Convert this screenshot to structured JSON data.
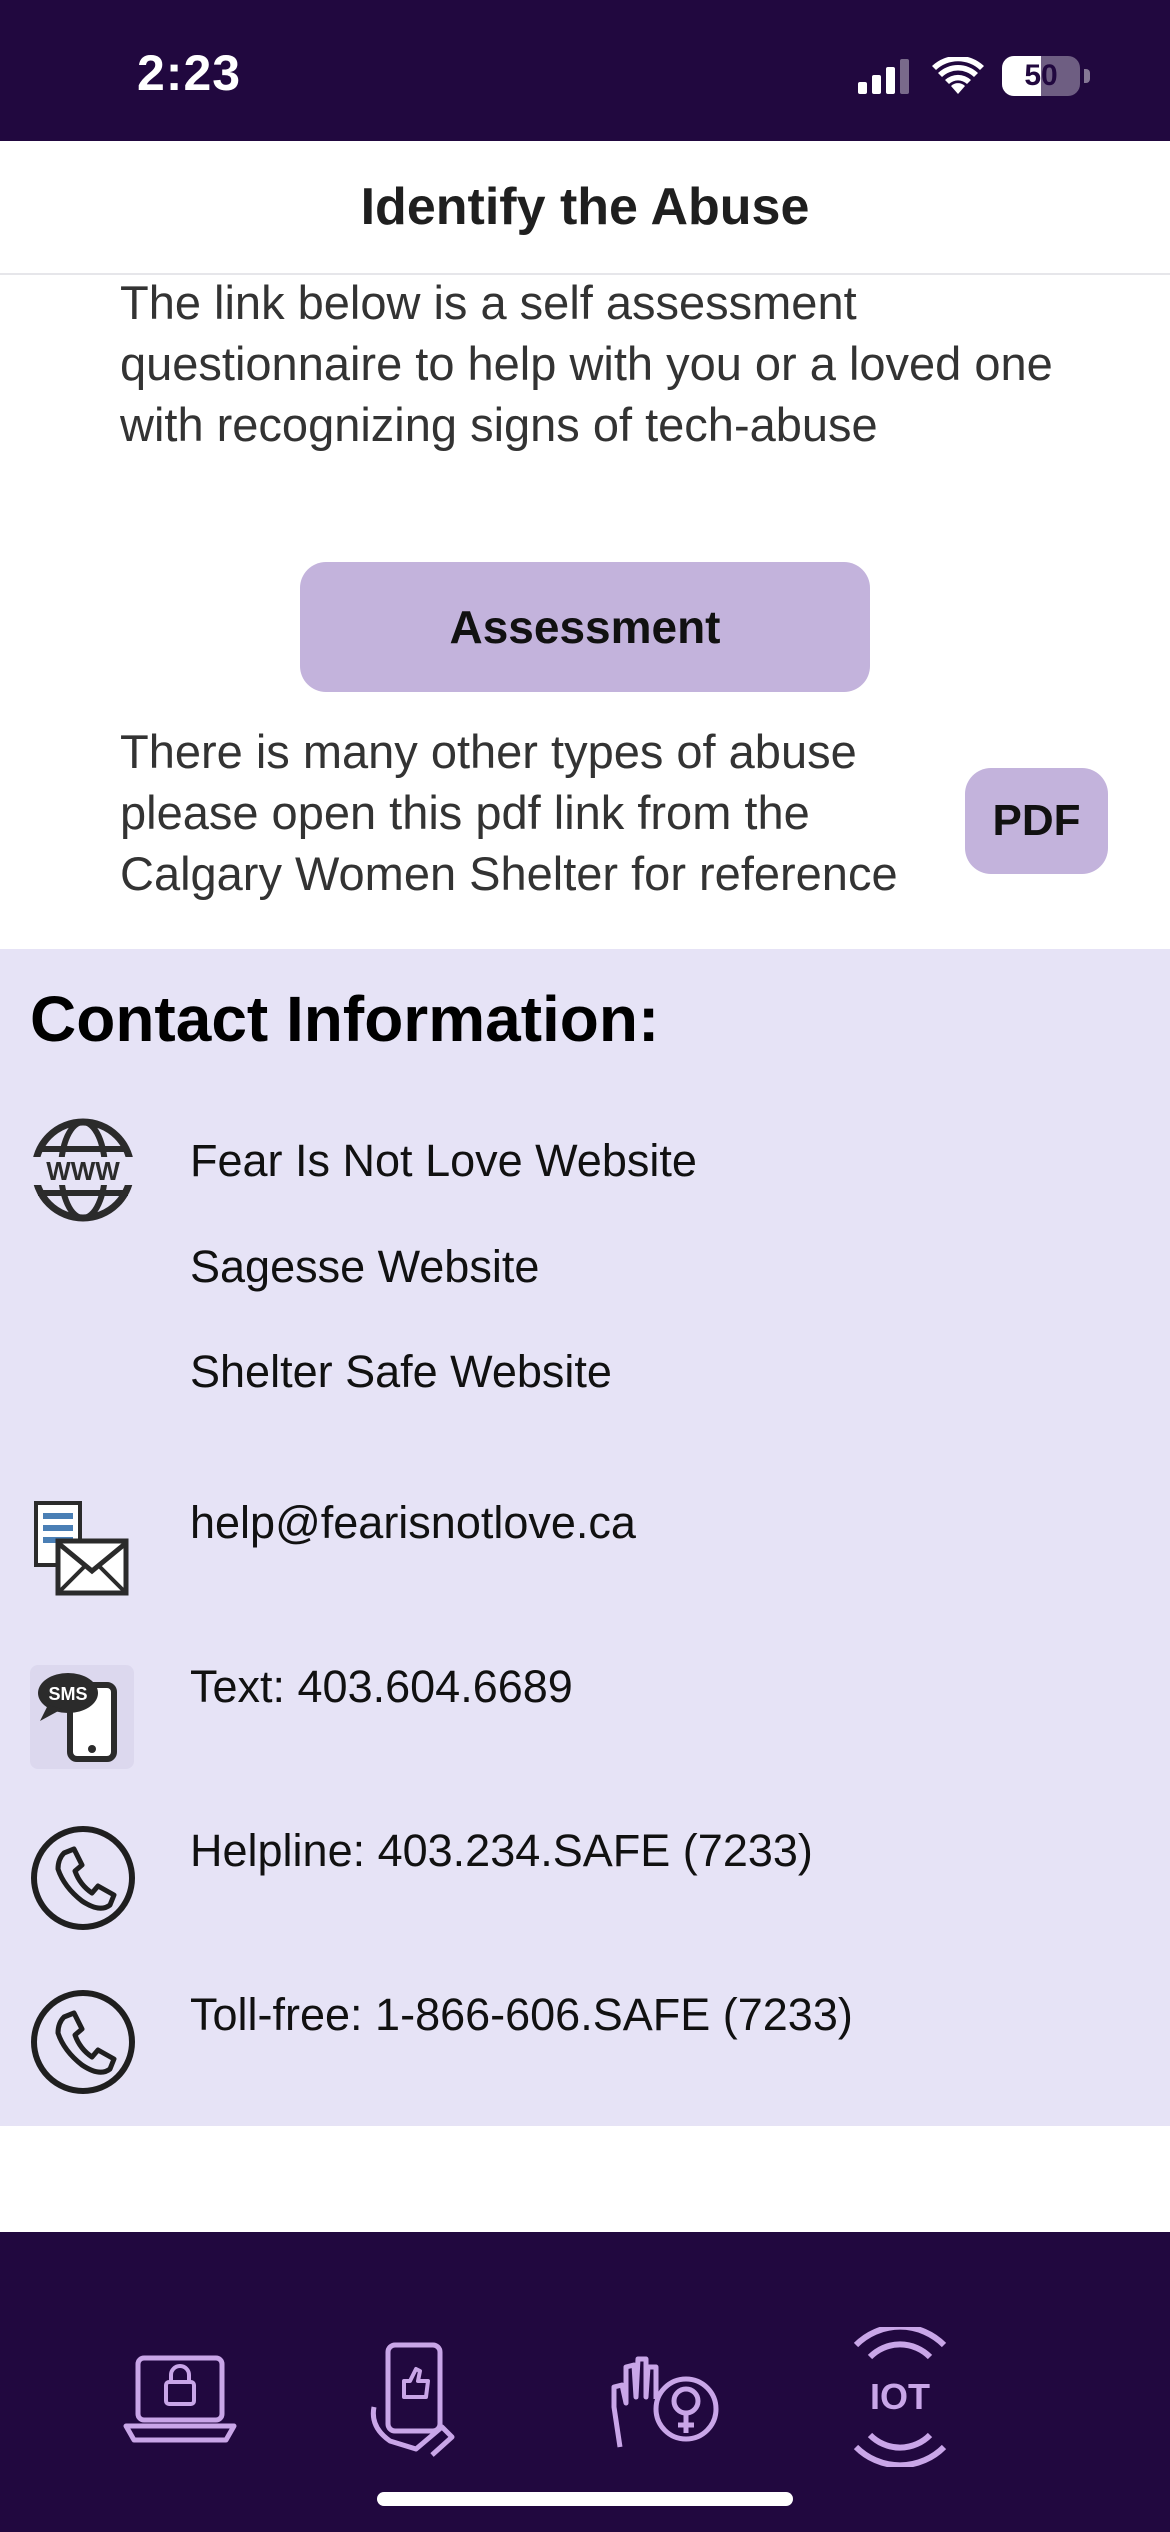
{
  "status_bar": {
    "time": "2:23",
    "battery_level": "50",
    "battery_percent": 50
  },
  "header": {
    "title": "Identify the Abuse"
  },
  "intro": {
    "text": "The link below is a self assessment questionnaire to help with you or a loved one with recognizing signs of tech-abuse",
    "assessment_button": "Assessment"
  },
  "pdf_section": {
    "text": "There is many other types of abuse please open this pdf link from the Calgary Women Shelter for reference",
    "pdf_button": "PDF"
  },
  "contact": {
    "title": "Contact Information:",
    "websites": [
      {
        "label": "Fear Is Not Love Website"
      },
      {
        "label": "Sagesse Website"
      },
      {
        "label": "Shelter Safe Website"
      }
    ],
    "email": "help@fearisnotlove.ca",
    "sms_badge": "SMS",
    "www_badge": "WWW",
    "text_line": "Text: 403.604.6689",
    "helpline": "Helpline: 403.234.SAFE (7233)",
    "tollfree": "Toll-free: 1-866-606.SAFE (7233)"
  },
  "tab_bar": {
    "iot_label": "IOT",
    "tabs": [
      {
        "icon": "laptop-lock-icon"
      },
      {
        "icon": "phone-like-icon"
      },
      {
        "icon": "hand-female-icon"
      },
      {
        "icon": "iot-icon"
      }
    ]
  },
  "colors": {
    "header_bg": "#21083f",
    "button_bg": "#c3b3dc",
    "contact_bg": "#e6e3f6",
    "tab_icon": "#c9a6e8"
  }
}
